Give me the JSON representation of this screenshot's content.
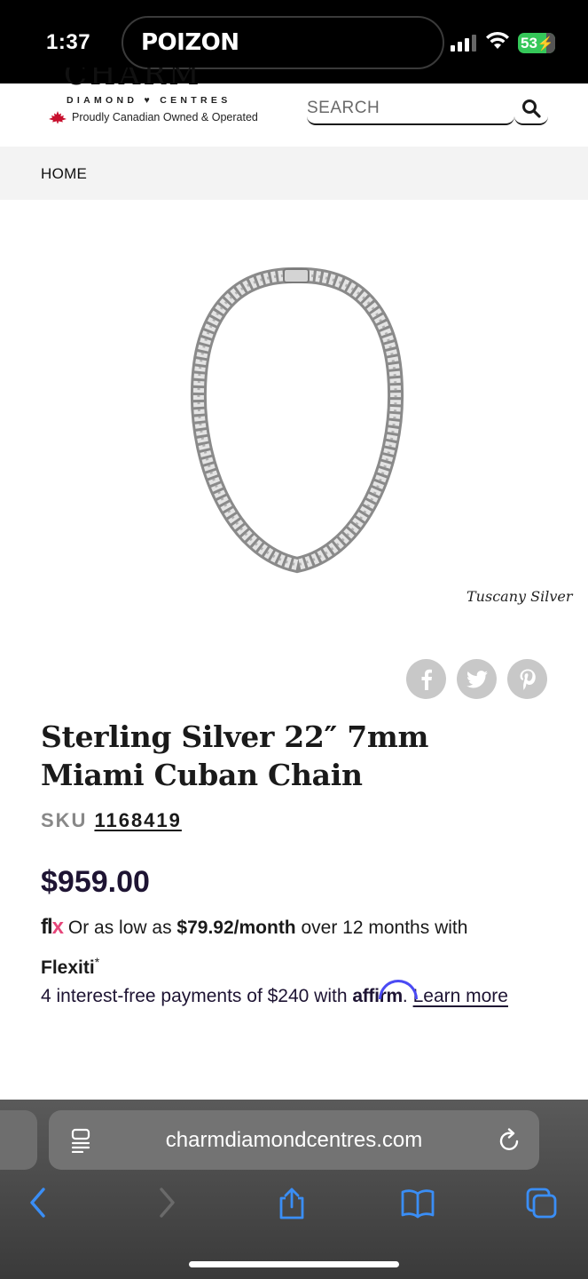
{
  "status": {
    "time": "1:37",
    "island_app": "POIZON",
    "battery": "53"
  },
  "header": {
    "logo_text": "CHARM",
    "logo_sub": "DIAMOND ♥ CENTRES",
    "tagline": "Proudly Canadian Owned & Operated",
    "search_placeholder": "SEARCH"
  },
  "breadcrumb": {
    "home": "HOME"
  },
  "product": {
    "brand_watermark": "Tuscany Silver",
    "title": "Sterling Silver 22″ 7mm Miami Cuban Chain",
    "sku_label": "SKU",
    "sku": "1168419",
    "price": "$959.00"
  },
  "financing": {
    "flexiti_prefix": "Or as low as",
    "flexiti_amount": "$79.92/month",
    "flexiti_suffix": "over 12 months with",
    "flexiti_name": "Flexiti",
    "flexiti_mark": "*",
    "affirm_prefix": "4 interest-free payments of $240 with",
    "affirm_logo": "affirm",
    "affirm_dot": ".",
    "learn_more": "Learn more"
  },
  "browser": {
    "url": "charmdiamondcentres.com"
  },
  "icons": {
    "share": [
      "facebook-icon",
      "twitter-icon",
      "pinterest-icon"
    ],
    "toolbar": [
      "back-icon",
      "forward-icon",
      "share-icon",
      "bookmarks-icon",
      "tabs-icon"
    ]
  },
  "colors": {
    "accent_price": "#1e1433",
    "flexiti_pink": "#e6467a",
    "affirm_blue": "#4a4af4",
    "ios_blue": "#3a8ef6",
    "battery_green": "#35c759"
  }
}
